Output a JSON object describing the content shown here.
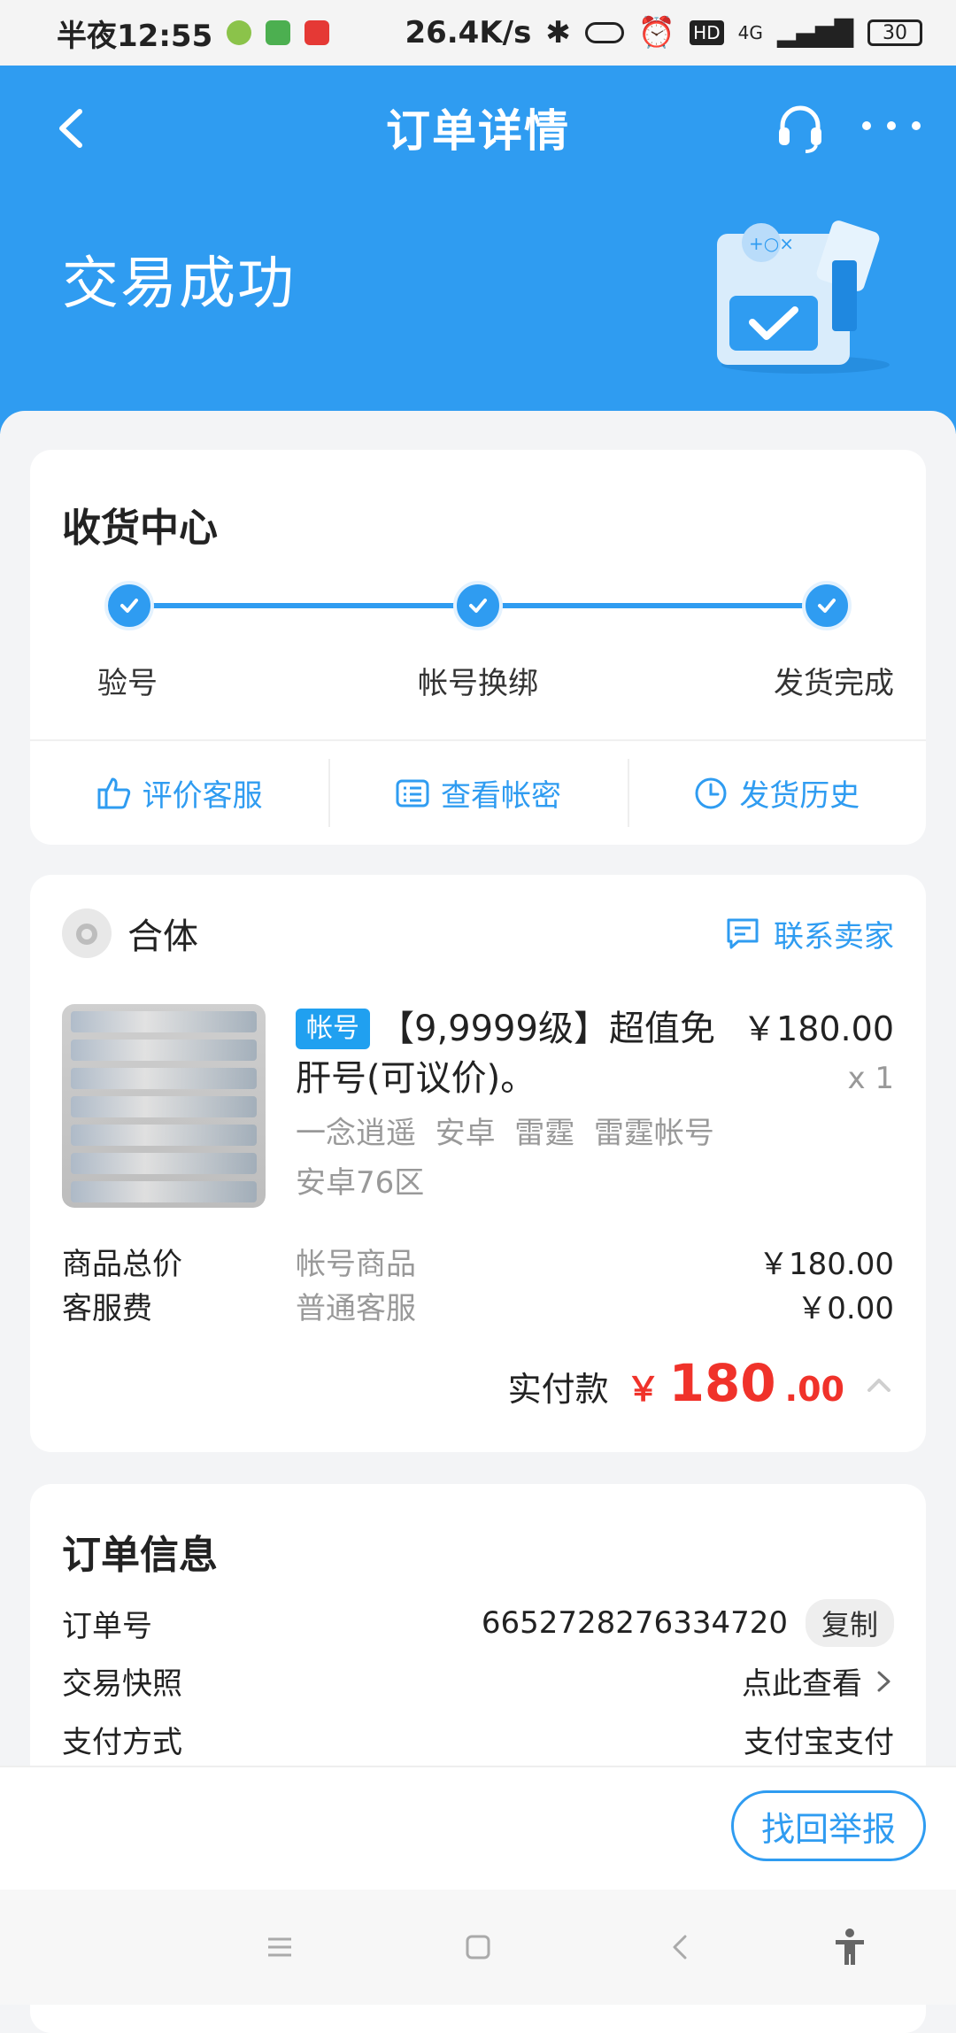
{
  "status_bar": {
    "time": "半夜12:55",
    "network_speed": "26.4K/s",
    "network_type": "4G",
    "battery": "30"
  },
  "header": {
    "title": "订单详情",
    "status": "交易成功",
    "accent_color": "#2f9cf1"
  },
  "receive_center": {
    "title": "收货中心",
    "steps": [
      {
        "label": "验号"
      },
      {
        "label": "帐号换绑"
      },
      {
        "label": "发货完成"
      }
    ],
    "actions": [
      {
        "label": "评价客服",
        "icon": "thumbs-up-icon"
      },
      {
        "label": "查看帐密",
        "icon": "list-icon"
      },
      {
        "label": "发货历史",
        "icon": "clock-icon"
      }
    ]
  },
  "order_item": {
    "shop_name": "合体",
    "contact_label": "联系卖家",
    "tag": "帐号",
    "title": "【9,9999级】超值免肝号(可议价)。",
    "price": "￥180.00",
    "quantity": "x 1",
    "attributes": "一念逍遥  安卓  雷霆  雷霆帐号",
    "region": "安卓76区",
    "fees": [
      {
        "label": "商品总价",
        "desc": "帐号商品",
        "value": "￥180.00"
      },
      {
        "label": "客服费",
        "desc": "普通客服",
        "value": "￥0.00"
      }
    ],
    "paid_label": "实付款",
    "paid_currency": "￥",
    "paid_integer": "180",
    "paid_decimal": ".00",
    "price_color": "#f0322a"
  },
  "order_info": {
    "title": "订单信息",
    "rows": [
      {
        "label": "订单号",
        "value": "6652728276334720",
        "action": "复制"
      },
      {
        "label": "交易快照",
        "value": "点此查看"
      },
      {
        "label": "支付方式",
        "value": "支付宝支付"
      }
    ]
  },
  "bottom": {
    "report_label": "找回举报"
  }
}
